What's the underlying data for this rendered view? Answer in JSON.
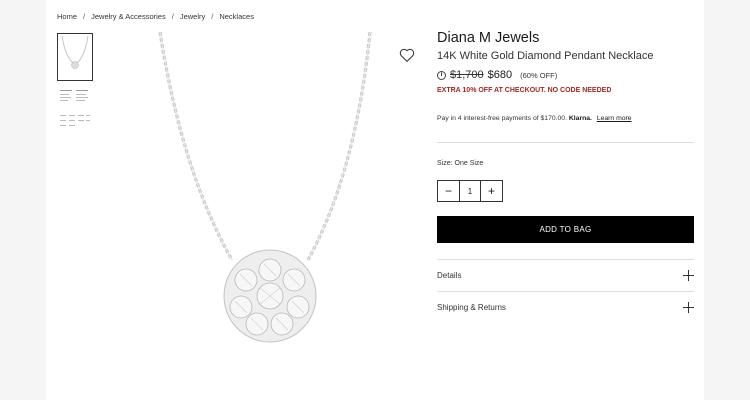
{
  "breadcrumb": [
    "Home",
    "Jewelry & Accessories",
    "Jewelry",
    "Necklaces"
  ],
  "product": {
    "brand": "Diana M Jewels",
    "name": "14K White Gold Diamond Pendant Necklace",
    "original_price": "$1,700",
    "sale_price": "$680",
    "discount": "(60% OFF)",
    "promo": "EXTRA 10% OFF AT CHECKOUT. NO CODE NEEDED"
  },
  "klarna": {
    "text": "Pay in 4 interest-free payments of $170.00.",
    "brand": "Klarna.",
    "link": "Learn more"
  },
  "size": {
    "label": "Size:",
    "value": "One Size"
  },
  "quantity": {
    "minus": "−",
    "value": "1",
    "plus": "+"
  },
  "add_to_bag": "ADD TO BAG",
  "accordion": [
    "Details",
    "Shipping & Returns"
  ],
  "colors": {
    "promo": "#a62626",
    "button": "#000000"
  },
  "icons": {
    "wishlist": "heart-icon",
    "info": "info-icon",
    "expand": "plus-icon"
  }
}
